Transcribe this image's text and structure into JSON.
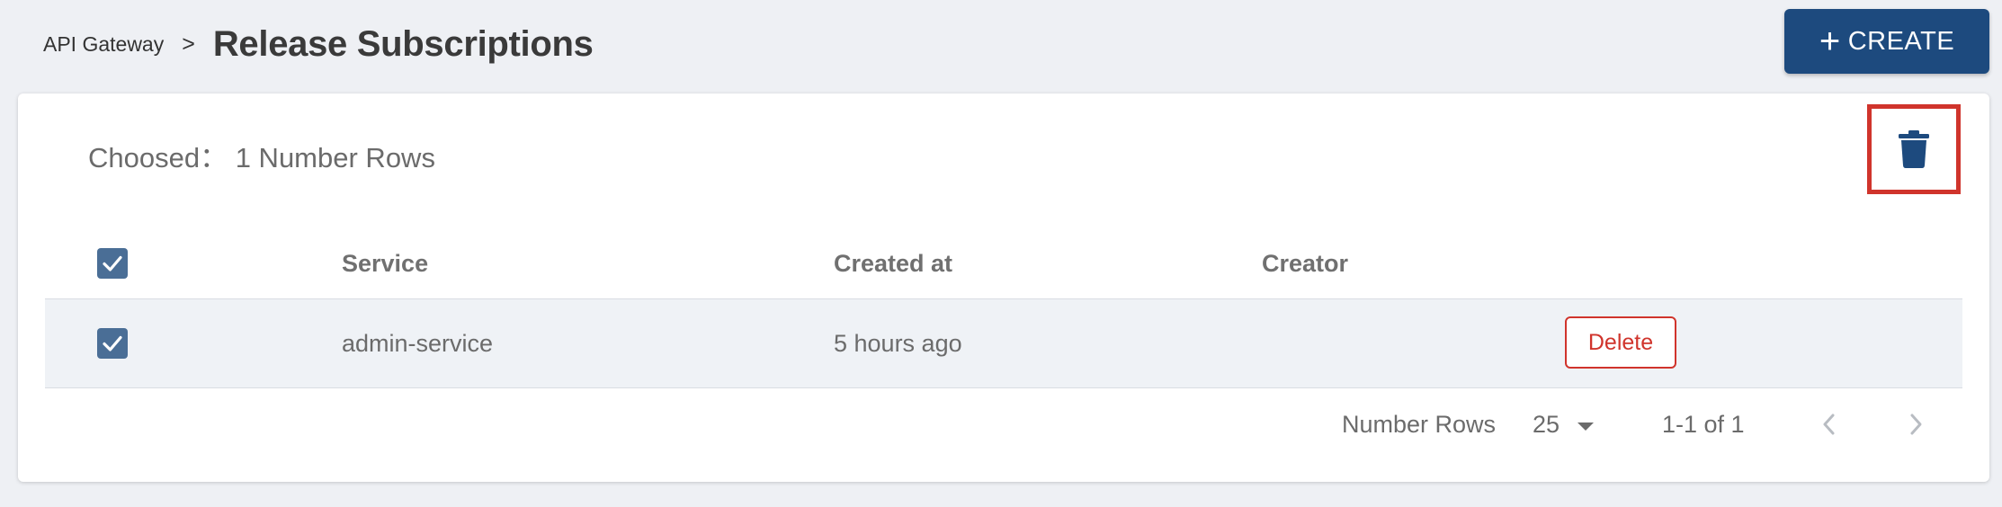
{
  "header": {
    "breadcrumb_parent": "API Gateway",
    "breadcrumb_separator": ">",
    "title": "Release Subscriptions",
    "create_label": "CREATE"
  },
  "selection": {
    "text": "Choosed： 1 Number Rows"
  },
  "table": {
    "columns": [
      "Service",
      "Created at",
      "Creator"
    ],
    "rows": [
      {
        "service": "admin-service",
        "created_at": "5 hours ago",
        "creator": "",
        "action_label": "Delete",
        "checked": true
      }
    ]
  },
  "pagination": {
    "rows_label": "Number Rows",
    "rows_per_page": "25",
    "range_text": "1-1 of 1"
  },
  "colors": {
    "primary": "#1d4a7e",
    "danger": "#d0342c",
    "checkbox": "#4a6e96",
    "background": "#eef0f4"
  },
  "icons": [
    "plus-icon",
    "trash-icon",
    "check-icon",
    "chevron-left-icon",
    "chevron-right-icon",
    "caret-down-icon"
  ]
}
